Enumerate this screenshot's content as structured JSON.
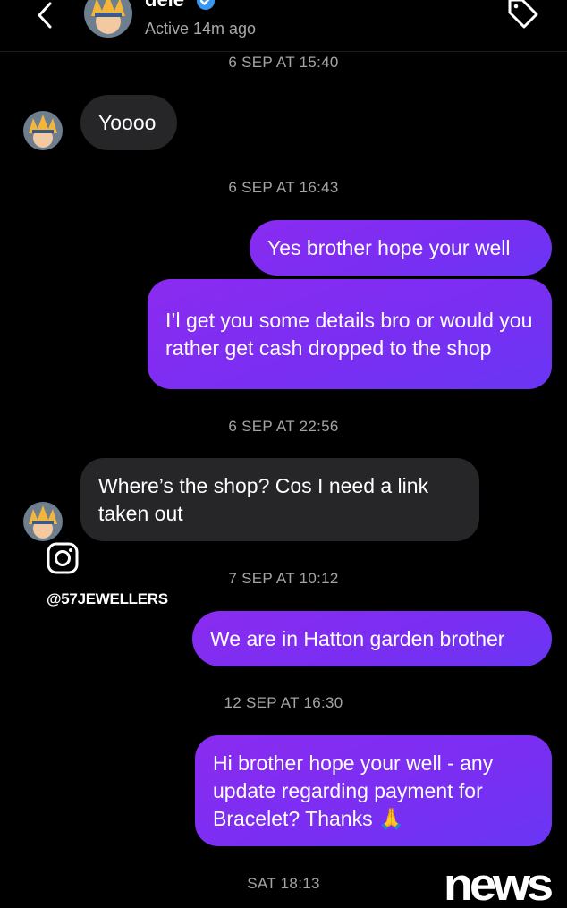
{
  "header": {
    "name": "dele",
    "status": "Active 14m ago",
    "back_icon": "chevron-left-icon",
    "action_icon": "tag-icon",
    "verified_icon": "verified-badge-icon"
  },
  "timestamps": [
    "6 SEP AT 15:40",
    "6 SEP AT 16:43",
    "6 SEP AT 22:56",
    "7 SEP AT 10:12",
    "12 SEP AT 16:30",
    "SAT 18:13"
  ],
  "messages": [
    {
      "from": "them",
      "text": "Yoooo"
    },
    {
      "from": "me",
      "text": "Yes brother hope your well"
    },
    {
      "from": "me",
      "text": "I’l get you some details bro or would you rather get cash dropped to the shop"
    },
    {
      "from": "them",
      "text": "Where’s the shop? Cos I need a link taken out"
    },
    {
      "from": "me",
      "text": "We are in Hatton garden brother"
    },
    {
      "from": "me",
      "text": "Hi brother hope your well -  any update regarding payment for Bracelet? Thanks 🙏"
    }
  ],
  "watermark": {
    "instagram_icon": "instagram-icon",
    "handle": "@57JEWELLERS",
    "logo": "news"
  },
  "colors": {
    "background": "#000000",
    "received_bubble": "#262628",
    "sent_bubble": "#7a2ef2",
    "timestamp": "#a4a4a4",
    "verified": "#3897f0"
  }
}
